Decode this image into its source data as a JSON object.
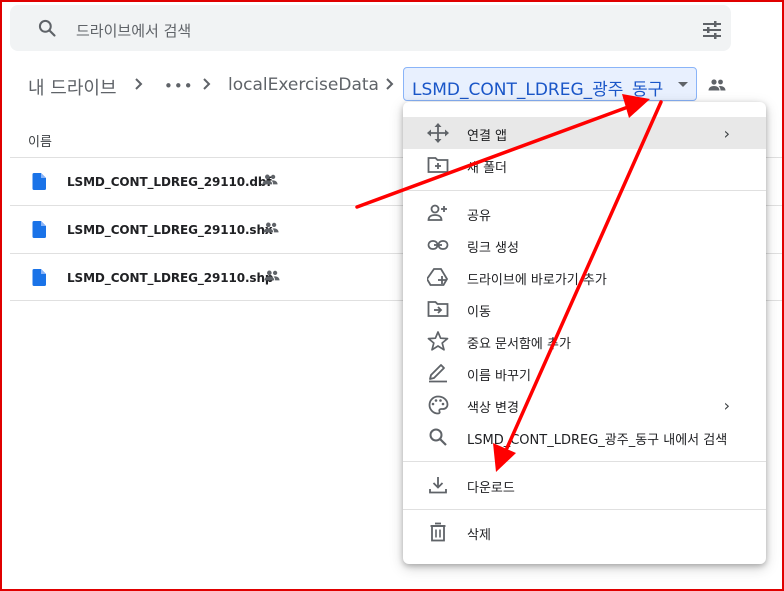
{
  "search": {
    "placeholder": "드라이브에서 검색"
  },
  "breadcrumb": {
    "root": "내 드라이브",
    "more": "•••",
    "folder": "localExerciseData",
    "current": "LSMD_CONT_LDREG_광주_동구"
  },
  "list": {
    "column_name": "이름",
    "files": [
      {
        "name": "LSMD_CONT_LDREG_29110.dbf"
      },
      {
        "name": "LSMD_CONT_LDREG_29110.shx"
      },
      {
        "name": "LSMD_CONT_LDREG_29110.shp"
      }
    ]
  },
  "menu": {
    "items": [
      {
        "label": "연결 앱",
        "icon": "move-arrows-icon",
        "submenu": true
      },
      {
        "label": "새 폴더",
        "icon": "new-folder-icon"
      },
      {
        "label": "공유",
        "icon": "person-add-icon"
      },
      {
        "label": "링크 생성",
        "icon": "link-icon"
      },
      {
        "label": "드라이브에 바로가기 추가",
        "icon": "drive-shortcut-icon"
      },
      {
        "label": "이동",
        "icon": "move-folder-icon"
      },
      {
        "label": "중요 문서함에 추가",
        "icon": "star-icon"
      },
      {
        "label": "이름 바꾸기",
        "icon": "pencil-icon"
      },
      {
        "label": "색상 변경",
        "icon": "palette-icon",
        "submenu": true
      },
      {
        "label": "LSMD_CONT_LDREG_광주_동구 내에서 검색",
        "icon": "search-icon"
      },
      {
        "label": "다운로드",
        "icon": "download-icon"
      },
      {
        "label": "삭제",
        "icon": "trash-icon"
      }
    ],
    "submenu_glyph": "›"
  },
  "colors": {
    "accent": "#1a56c8",
    "annotation": "#ff0000",
    "menu_highlight": "#e8e8e8"
  }
}
